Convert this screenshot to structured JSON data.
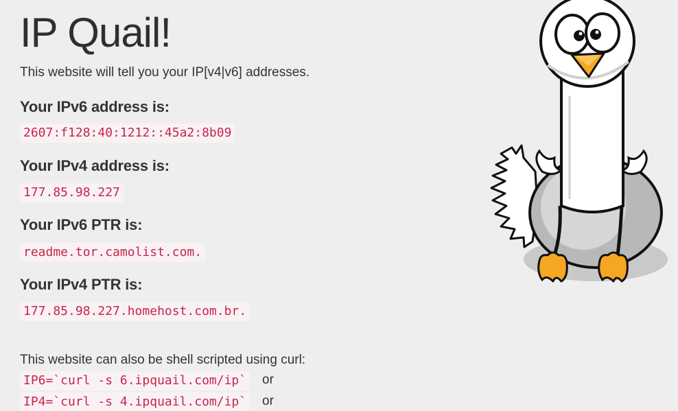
{
  "header": {
    "title": "IP Quail!",
    "lead": "This website will tell you your IP[v4|v6] addresses."
  },
  "sections": [
    {
      "heading": "Your IPv6 address is:",
      "value": "2607:f128:40:1212::45a2:8b09"
    },
    {
      "heading": "Your IPv4 address is:",
      "value": "177.85.98.227"
    },
    {
      "heading": "Your IPv6 PTR is:",
      "value": "readme.tor.camolist.com."
    },
    {
      "heading": "Your IPv4 PTR is:",
      "value": "177.85.98.227.homehost.com.br."
    }
  ],
  "shell": {
    "intro": "This website can also be shell scripted using curl:",
    "commands": [
      {
        "code": "IP6=`curl -s 6.ipquail.com/ip`",
        "suffix": "or"
      },
      {
        "code": "IP4=`curl -s 4.ipquail.com/ip`",
        "suffix": "or"
      }
    ]
  },
  "mascot": {
    "icon": "quail-mascot-icon"
  },
  "colors": {
    "background": "#eeeeee",
    "code_text": "#c7254e",
    "code_bg": "#f9f2f4",
    "text": "#333333"
  }
}
